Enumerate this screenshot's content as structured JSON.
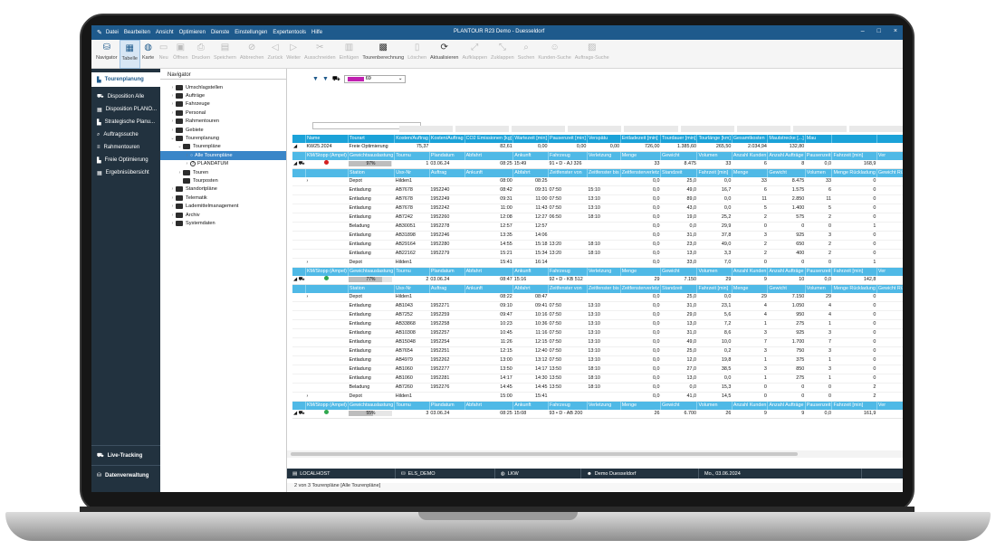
{
  "titlebar": {
    "menu": [
      "Datei",
      "Bearbeiten",
      "Ansicht",
      "Optimieren",
      "Dienste",
      "Einstellungen",
      "Expertentools",
      "Hilfe"
    ],
    "title": "PLANTOUR R23 Demo - Duesseldorf",
    "controls": [
      "–",
      "□",
      "×"
    ]
  },
  "ribbon": {
    "items": [
      {
        "label": "Navigator",
        "icon": "database-icon",
        "dim": false,
        "selected": false
      },
      {
        "label": "Tabelle",
        "icon": "table-icon",
        "dim": false,
        "selected": true
      },
      {
        "label": "Karte",
        "icon": "globe-icon",
        "dim": false,
        "selected": false
      },
      {
        "label": "Neu",
        "icon": "new-icon",
        "dim": true
      },
      {
        "label": "Öffnen",
        "icon": "open-icon",
        "dim": true
      },
      {
        "label": "Drucken",
        "icon": "print-icon",
        "dim": true
      },
      {
        "label": "Speichern",
        "icon": "save-icon",
        "dim": true
      },
      {
        "label": "Abbrechen",
        "icon": "cancel-icon",
        "dim": true
      },
      {
        "label": "Zurück",
        "icon": "back-icon",
        "dim": true
      },
      {
        "label": "Weiter",
        "icon": "forward-icon",
        "dim": true
      },
      {
        "label": "Ausschneiden",
        "icon": "cut-icon",
        "dim": true
      },
      {
        "label": "Einfügen",
        "icon": "paste-icon",
        "dim": true
      },
      {
        "label": "Tourenberechnung",
        "icon": "calculator-icon",
        "dim": false
      },
      {
        "label": "Löschen",
        "icon": "delete-icon",
        "dim": true
      },
      {
        "label": "Aktualisieren",
        "icon": "refresh-icon",
        "dim": false
      },
      {
        "label": "Aufklappen",
        "icon": "expand-icon",
        "dim": true
      },
      {
        "label": "Zuklappen",
        "icon": "collapse-icon",
        "dim": true
      },
      {
        "label": "Suchen",
        "icon": "search-icon",
        "dim": true
      },
      {
        "label": "Kunden-Suche",
        "icon": "customer-search-icon",
        "dim": true
      },
      {
        "label": "Auftrags-Suche",
        "icon": "order-search-icon",
        "dim": true
      }
    ]
  },
  "sidebar": {
    "top": [
      {
        "label": "Tourenplanung",
        "icon": "chart-icon",
        "active": true
      },
      {
        "label": "Disposition Alle",
        "icon": "truck-icon"
      },
      {
        "label": "Disposition PLANO...",
        "icon": "calendar-icon"
      },
      {
        "label": "Strategische Planu...",
        "icon": "chart-icon"
      },
      {
        "label": "Auftragssuche",
        "icon": "search-icon"
      },
      {
        "label": "Rahmentouren",
        "icon": "list-icon"
      },
      {
        "label": "Freie Optimierung",
        "icon": "chart-icon"
      },
      {
        "label": "Ergebnisübersicht",
        "icon": "grid-icon"
      }
    ],
    "bottom": [
      {
        "label": "Live-Tracking",
        "icon": "car-icon"
      },
      {
        "label": "Datenverwaltung",
        "icon": "database-icon"
      }
    ]
  },
  "navigator": {
    "tab": "Navigator",
    "tree": [
      {
        "label": "Umschlagstellen",
        "level": 0,
        "caret": ">"
      },
      {
        "label": "Aufträge",
        "level": 0,
        "caret": ">"
      },
      {
        "label": "Fahrzeuge",
        "level": 0,
        "caret": ">"
      },
      {
        "label": "Personal",
        "level": 0,
        "caret": ">"
      },
      {
        "label": "Rahmentouren",
        "level": 0,
        "caret": ">"
      },
      {
        "label": "Gebiete",
        "level": 0,
        "caret": ">"
      },
      {
        "label": "Tourenplanung",
        "level": 0,
        "caret": "v"
      },
      {
        "label": "Tourenpläne",
        "level": 1,
        "caret": "v"
      },
      {
        "label": "Alle Tourenpläne",
        "level": 2,
        "caret": ">",
        "selected": true
      },
      {
        "label": "PLANDATUM",
        "level": 2,
        "caret": ">"
      },
      {
        "label": "Touren",
        "level": 1,
        "caret": ">"
      },
      {
        "label": "Tourposten",
        "level": 1,
        "caret": ""
      },
      {
        "label": "Standortpläne",
        "level": 0,
        "caret": ">"
      },
      {
        "label": "Telematik",
        "level": 0,
        "caret": ">"
      },
      {
        "label": "Lademittelmanagement",
        "level": 0,
        "caret": ">"
      },
      {
        "label": "Archiv",
        "level": 0,
        "caret": ">"
      },
      {
        "label": "Systemdaten",
        "level": 0,
        "caret": ">"
      }
    ]
  },
  "filter": {
    "color_value": "69",
    "accent": "#c020b0"
  },
  "plan": {
    "headers": [
      "Name",
      "Tourart",
      "Kosten/Auftrag",
      "Kosten/Auftrag",
      "CO2 Emissionen [kg]",
      "Wartezeit [min]",
      "Pausenzeit [min]",
      "Verspätu",
      "Entladezeit [min]",
      "Tourdauer [min]",
      "Tourlänge [km]",
      "Gesamtkosten",
      "Mautstrecke [...]",
      "Mau"
    ],
    "row": [
      "KW25.2024",
      "Freie Optimierung",
      "75,37",
      "",
      "82,61",
      "0,00",
      "0,00",
      "0,00",
      "726,00",
      "1.385,60",
      "265,50",
      "2.034,94",
      "132,80",
      ""
    ]
  },
  "tour_headers": [
    "KM/Stopp (Ampel)",
    "Gewichtsauslastung",
    "Tournu",
    "Plandatum",
    "Abfahrt",
    "Ankunft",
    "Fahrzeug",
    "Verletzung",
    "Menge",
    "Gewicht",
    "Volumen",
    "Anzahl Kunden",
    "Anzahl Aufträge",
    "Pausenzeit",
    "Fahrzeit [min]",
    "Ver"
  ],
  "stop_headers": [
    "Station",
    "Usx-Nr",
    "Auftrag",
    "Ankunft",
    "Abfahrt",
    "Zeitfenster von",
    "Zeitfenster bis",
    "Zeitfensterverletz",
    "Standzeit",
    "Fahrzeit [min]",
    "Menge",
    "Gewicht",
    "Volumen",
    "Menge Rückladung",
    "Gewicht Rückladung",
    "Vol"
  ],
  "tours": [
    {
      "ampel": "#d32020",
      "load": "97%",
      "load_pct": 97,
      "nr": "1",
      "date": "03.06.24",
      "dep": "08:25",
      "arr": "15:49",
      "vehicle": "91 • D - AJ 326",
      "menge": "33",
      "gewicht": "8.475",
      "volumen": "33",
      "kunden": "6",
      "auftraege": "8",
      "pause": "0,0",
      "fahrzeit": "168,9",
      "stops": [
        [
          "Depot",
          "Hilden1",
          "",
          "08:00",
          "08:25",
          "",
          "",
          "0,0",
          "25,0",
          "0,0",
          "33",
          "8.475",
          "33",
          "0",
          "0",
          "depot"
        ],
        [
          "Entladung",
          "AB7678",
          "1952240",
          "08:42",
          "09:31",
          "07:50",
          "15:10",
          "0,0",
          "49,0",
          "16,7",
          "6",
          "1.575",
          "6",
          "0",
          "0",
          "orange"
        ],
        [
          "Entladung",
          "AB7678",
          "1952249",
          "09:31",
          "11:00",
          "07:50",
          "13:10",
          "0,0",
          "89,0",
          "0,0",
          "11",
          "2.850",
          "11",
          "0",
          "0",
          "truck"
        ],
        [
          "Entladung",
          "AB7678",
          "1952242",
          "11:00",
          "11:43",
          "07:50",
          "13:10",
          "0,0",
          "43,0",
          "0,0",
          "5",
          "1.400",
          "5",
          "0",
          "0",
          "truck"
        ],
        [
          "Entladung",
          "AB7242",
          "1952260",
          "12:08",
          "12:27",
          "06:50",
          "18:10",
          "0,0",
          "19,0",
          "25,2",
          "2",
          "575",
          "2",
          "0",
          "0",
          "orange"
        ],
        [
          "Beladung",
          "AB30051",
          "1952278",
          "12:57",
          "12:57",
          "",
          "",
          "0,0",
          "0,0",
          "29,9",
          "0",
          "0",
          "0",
          "1",
          "275",
          "beige"
        ],
        [
          "Entladung",
          "AB31898",
          "1952246",
          "13:35",
          "14:06",
          "",
          "",
          "0,0",
          "31,0",
          "37,8",
          "3",
          "925",
          "3",
          "0",
          "0",
          "truck"
        ],
        [
          "Entladung",
          "AB29164",
          "1952280",
          "14:55",
          "15:18",
          "13:20",
          "18:10",
          "0,0",
          "23,0",
          "49,0",
          "2",
          "650",
          "2",
          "0",
          "0",
          "truck"
        ],
        [
          "Entladung",
          "AB22162",
          "1952279",
          "15:21",
          "15:34",
          "13:20",
          "18:10",
          "0,0",
          "13,0",
          "3,3",
          "2",
          "400",
          "2",
          "0",
          "0",
          "truck"
        ],
        [
          "Depot",
          "Hilden1",
          "",
          "15:41",
          "16:14",
          "",
          "",
          "0,0",
          "33,0",
          "7,0",
          "0",
          "0",
          "0",
          "1",
          "275",
          "depot"
        ]
      ]
    },
    {
      "ampel": "#2fa84f",
      "load": "77%",
      "load_pct": 77,
      "nr": "2",
      "date": "03.06.24",
      "dep": "08:47",
      "arr": "15:16",
      "vehicle": "92 • D - KB 512",
      "menge": "29",
      "gewicht": "7.150",
      "volumen": "29",
      "kunden": "9",
      "auftraege": "10",
      "pause": "0,0",
      "fahrzeit": "142,8",
      "stops": [
        [
          "Depot",
          "Hilden1",
          "",
          "08:22",
          "08:47",
          "",
          "",
          "0,0",
          "25,0",
          "0,0",
          "29",
          "7.150",
          "29",
          "0",
          "0",
          "depot"
        ],
        [
          "Entladung",
          "AB1043",
          "1952271",
          "09:10",
          "09:41",
          "07:50",
          "13:10",
          "0,0",
          "31,0",
          "23,1",
          "4",
          "1.050",
          "4",
          "0",
          "0",
          "truck"
        ],
        [
          "Entladung",
          "AB7252",
          "1952259",
          "09:47",
          "10:16",
          "07:50",
          "13:10",
          "0,0",
          "29,0",
          "5,6",
          "4",
          "950",
          "4",
          "0",
          "0",
          "truck"
        ],
        [
          "Entladung",
          "AB33868",
          "1952258",
          "10:23",
          "10:36",
          "07:50",
          "13:10",
          "0,0",
          "13,0",
          "7,2",
          "1",
          "275",
          "1",
          "0",
          "0",
          "truck"
        ],
        [
          "Entladung",
          "AB10308",
          "1952257",
          "10:45",
          "11:16",
          "07:50",
          "13:10",
          "0,0",
          "31,0",
          "8,6",
          "3",
          "925",
          "3",
          "0",
          "0",
          "truck"
        ],
        [
          "Entladung",
          "AB15048",
          "1952254",
          "11:26",
          "12:15",
          "07:50",
          "13:10",
          "0,0",
          "49,0",
          "10,0",
          "7",
          "1.700",
          "7",
          "0",
          "0",
          "truck"
        ],
        [
          "Entladung",
          "AB7654",
          "1952251",
          "12:15",
          "12:40",
          "07:50",
          "13:10",
          "0,0",
          "25,0",
          "0,2",
          "3",
          "750",
          "3",
          "0",
          "0",
          "truck"
        ],
        [
          "Entladung",
          "AB4979",
          "1952262",
          "13:00",
          "13:12",
          "07:50",
          "13:10",
          "0,0",
          "12,0",
          "19,8",
          "1",
          "375",
          "1",
          "0",
          "0",
          "truck"
        ],
        [
          "Entladung",
          "AB1060",
          "1952277",
          "13:50",
          "14:17",
          "13:50",
          "18:10",
          "0,0",
          "27,0",
          "38,5",
          "3",
          "850",
          "3",
          "0",
          "0",
          "truck"
        ],
        [
          "Entladung",
          "AB1060",
          "1952281",
          "14:17",
          "14:30",
          "13:50",
          "18:10",
          "0,0",
          "13,0",
          "0,0",
          "1",
          "275",
          "1",
          "0",
          "0",
          "truck"
        ],
        [
          "Beladung",
          "AB7260",
          "1952276",
          "14:45",
          "14:45",
          "13:50",
          "18:10",
          "0,0",
          "0,0",
          "15,3",
          "0",
          "0",
          "0",
          "2",
          "550",
          "orange"
        ],
        [
          "Depot",
          "Hilden1",
          "",
          "15:00",
          "15:41",
          "",
          "",
          "0,0",
          "41,0",
          "14,5",
          "0",
          "0",
          "0",
          "2",
          "550",
          "depot"
        ]
      ]
    },
    {
      "ampel": "#2fa84f",
      "load": "55%",
      "load_pct": 55,
      "nr": "3",
      "date": "03.06.24",
      "dep": "08:25",
      "arr": "15:08",
      "vehicle": "93 • D - AB 200",
      "menge": "26",
      "gewicht": "6.700",
      "volumen": "26",
      "kunden": "9",
      "auftraege": "9",
      "pause": "0,0",
      "fahrzeit": "161,9",
      "stops": []
    }
  ],
  "footer": {
    "text": "2  von  3  Tourenpläne  [Alle Tourenpläne]"
  },
  "statusbar": [
    {
      "label": "LOCALHOST",
      "icon": "server-icon"
    },
    {
      "label": "ELS_DEMO",
      "icon": "database-icon"
    },
    {
      "label": "LKW",
      "icon": "globe-icon"
    },
    {
      "label": "Demo Duesseldorf",
      "icon": "user-icon"
    },
    {
      "label": "Mo., 03.06.2024",
      "icon": ""
    }
  ]
}
